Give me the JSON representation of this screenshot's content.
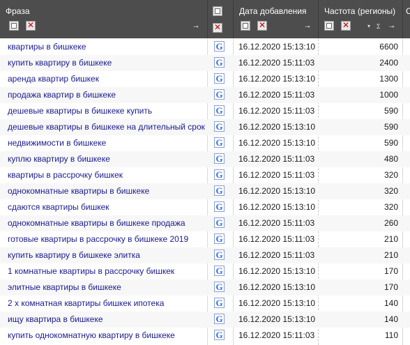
{
  "columns": {
    "phrase": "Фраза",
    "date": "Дата добавления",
    "freq": "Частота (регионы)",
    "extra": "С",
    "sigma": "Σ"
  },
  "rows": [
    {
      "phrase": "квартиры в бишкеке",
      "date": "16.12.2020 15:13:10",
      "freq": "6600"
    },
    {
      "phrase": "купить квартиру в бишкеке",
      "date": "16.12.2020 15:11:03",
      "freq": "2400"
    },
    {
      "phrase": "аренда квартир бишкек",
      "date": "16.12.2020 15:13:10",
      "freq": "1300"
    },
    {
      "phrase": "продажа квартир в бишкеке",
      "date": "16.12.2020 15:11:03",
      "freq": "1000"
    },
    {
      "phrase": "дешевые квартиры в бишкеке купить",
      "date": "16.12.2020 15:11:03",
      "freq": "590"
    },
    {
      "phrase": "дешевые квартиры в бишкеке на длительный срок",
      "date": "16.12.2020 15:13:10",
      "freq": "590"
    },
    {
      "phrase": "недвижимости в бишкеке",
      "date": "16.12.2020 15:13:10",
      "freq": "590"
    },
    {
      "phrase": "куплю квартиру в бишкеке",
      "date": "16.12.2020 15:11:03",
      "freq": "480"
    },
    {
      "phrase": "квартиры в рассрочку бишкек",
      "date": "16.12.2020 15:11:03",
      "freq": "320"
    },
    {
      "phrase": "однокомнатные квартиры в бишкеке",
      "date": "16.12.2020 15:13:10",
      "freq": "320"
    },
    {
      "phrase": "сдаются квартиры бишкек",
      "date": "16.12.2020 15:13:10",
      "freq": "320"
    },
    {
      "phrase": "однокомнатные квартиры в бишкеке продажа",
      "date": "16.12.2020 15:11:03",
      "freq": "260"
    },
    {
      "phrase": "готовые квартиры в рассрочку в бишкеке 2019",
      "date": "16.12.2020 15:11:03",
      "freq": "210"
    },
    {
      "phrase": "купить квартиру в бишкеке элитка",
      "date": "16.12.2020 15:11:03",
      "freq": "210"
    },
    {
      "phrase": "1 комнатные квартиры в рассрочку бишкек",
      "date": "16.12.2020 15:13:10",
      "freq": "170"
    },
    {
      "phrase": "элитные квартиры в бишкеке",
      "date": "16.12.2020 15:13:10",
      "freq": "170"
    },
    {
      "phrase": "2 х комнатная квартиры бишкек ипотека",
      "date": "16.12.2020 15:13:10",
      "freq": "140"
    },
    {
      "phrase": "ищу квартира в бишкеке",
      "date": "16.12.2020 15:13:10",
      "freq": "140"
    },
    {
      "phrase": "купить однокомнатную квартиру в бишкеке",
      "date": "16.12.2020 15:11:03",
      "freq": "110"
    }
  ],
  "icons": {
    "row_source": "google-g-icon",
    "column_filter": "filter-icon",
    "column_clear": "clear-filter-icon",
    "pin": "pin-icon",
    "sort": "sort-arrows-icon"
  },
  "colors": {
    "header_bg": "#4d4d4d",
    "phrase_link": "#1a1a8c",
    "google_blue": "#3a6fd8"
  },
  "google_glyph": "G"
}
